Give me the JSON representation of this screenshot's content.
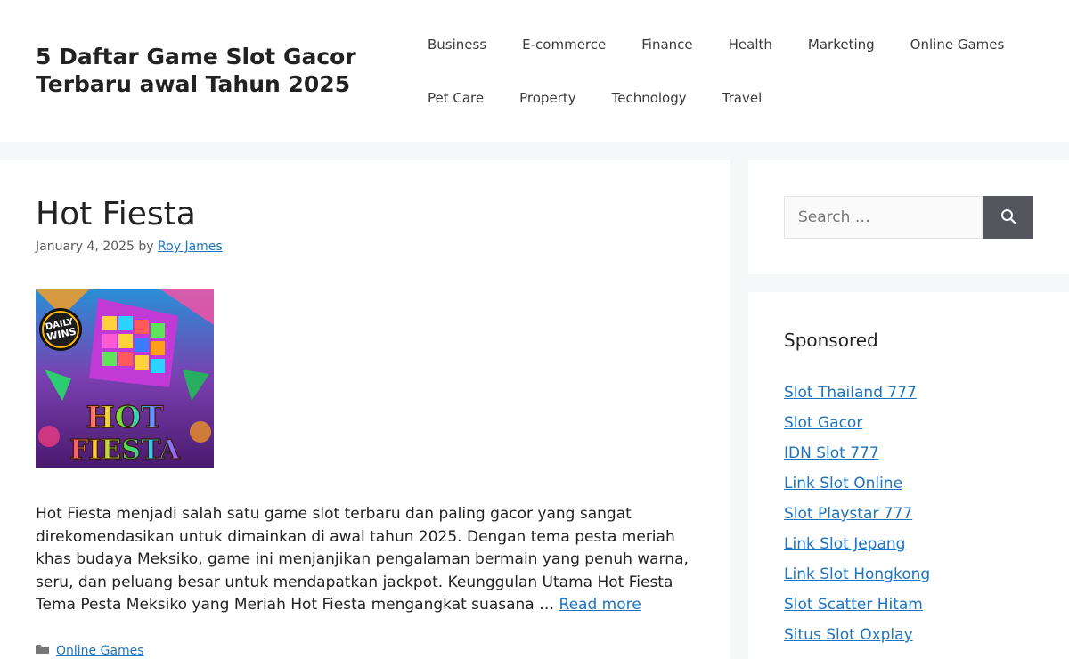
{
  "header": {
    "site_title": "5 Daftar Game Slot Gacor Terbaru awal Tahun 2025",
    "nav_row1": [
      "Business",
      "E-commerce",
      "Finance",
      "Health",
      "Marketing",
      "Online Games"
    ],
    "nav_row2": [
      "Pet Care",
      "Property",
      "Technology",
      "Travel"
    ]
  },
  "post": {
    "title": "Hot Fiesta",
    "date": "January 4, 2025",
    "by": "by",
    "author": "Roy James",
    "thumbnail": {
      "badge_line1": "DAILY",
      "badge_line2": "WINS",
      "logo_line1": "HOT",
      "logo_line2": "FIESTA"
    },
    "excerpt": "Hot Fiesta menjadi salah satu game slot terbaru dan paling gacor yang sangat direkomendasikan untuk dimainkan di awal tahun 2025. Dengan tema pesta meriah khas budaya Meksiko, game ini menjanjikan pengalaman bermain yang penuh warna, seru, dan peluang besar untuk mendapatkan jackpot. Keunggulan Utama Hot Fiesta Tema Pesta Meksiko yang Meriah Hot Fiesta mengangkat suasana …",
    "read_more": "Read more",
    "category": "Online Games"
  },
  "sidebar": {
    "search_placeholder": "Search …",
    "sponsored_title": "Sponsored",
    "links": [
      "Slot Thailand 777",
      "Slot Gacor",
      "IDN Slot 777",
      "Link Slot Online",
      "Slot Playstar 777",
      "Link Slot Jepang",
      "Link Slot Hongkong",
      "Slot Scatter Hitam",
      "Situs Slot Oxplay"
    ]
  },
  "colors": {
    "link": "#1e73be",
    "background": "#f6f7f8",
    "search_button": "#55555e"
  },
  "icons": {
    "search_button": "search-icon",
    "category": "folder-icon"
  }
}
